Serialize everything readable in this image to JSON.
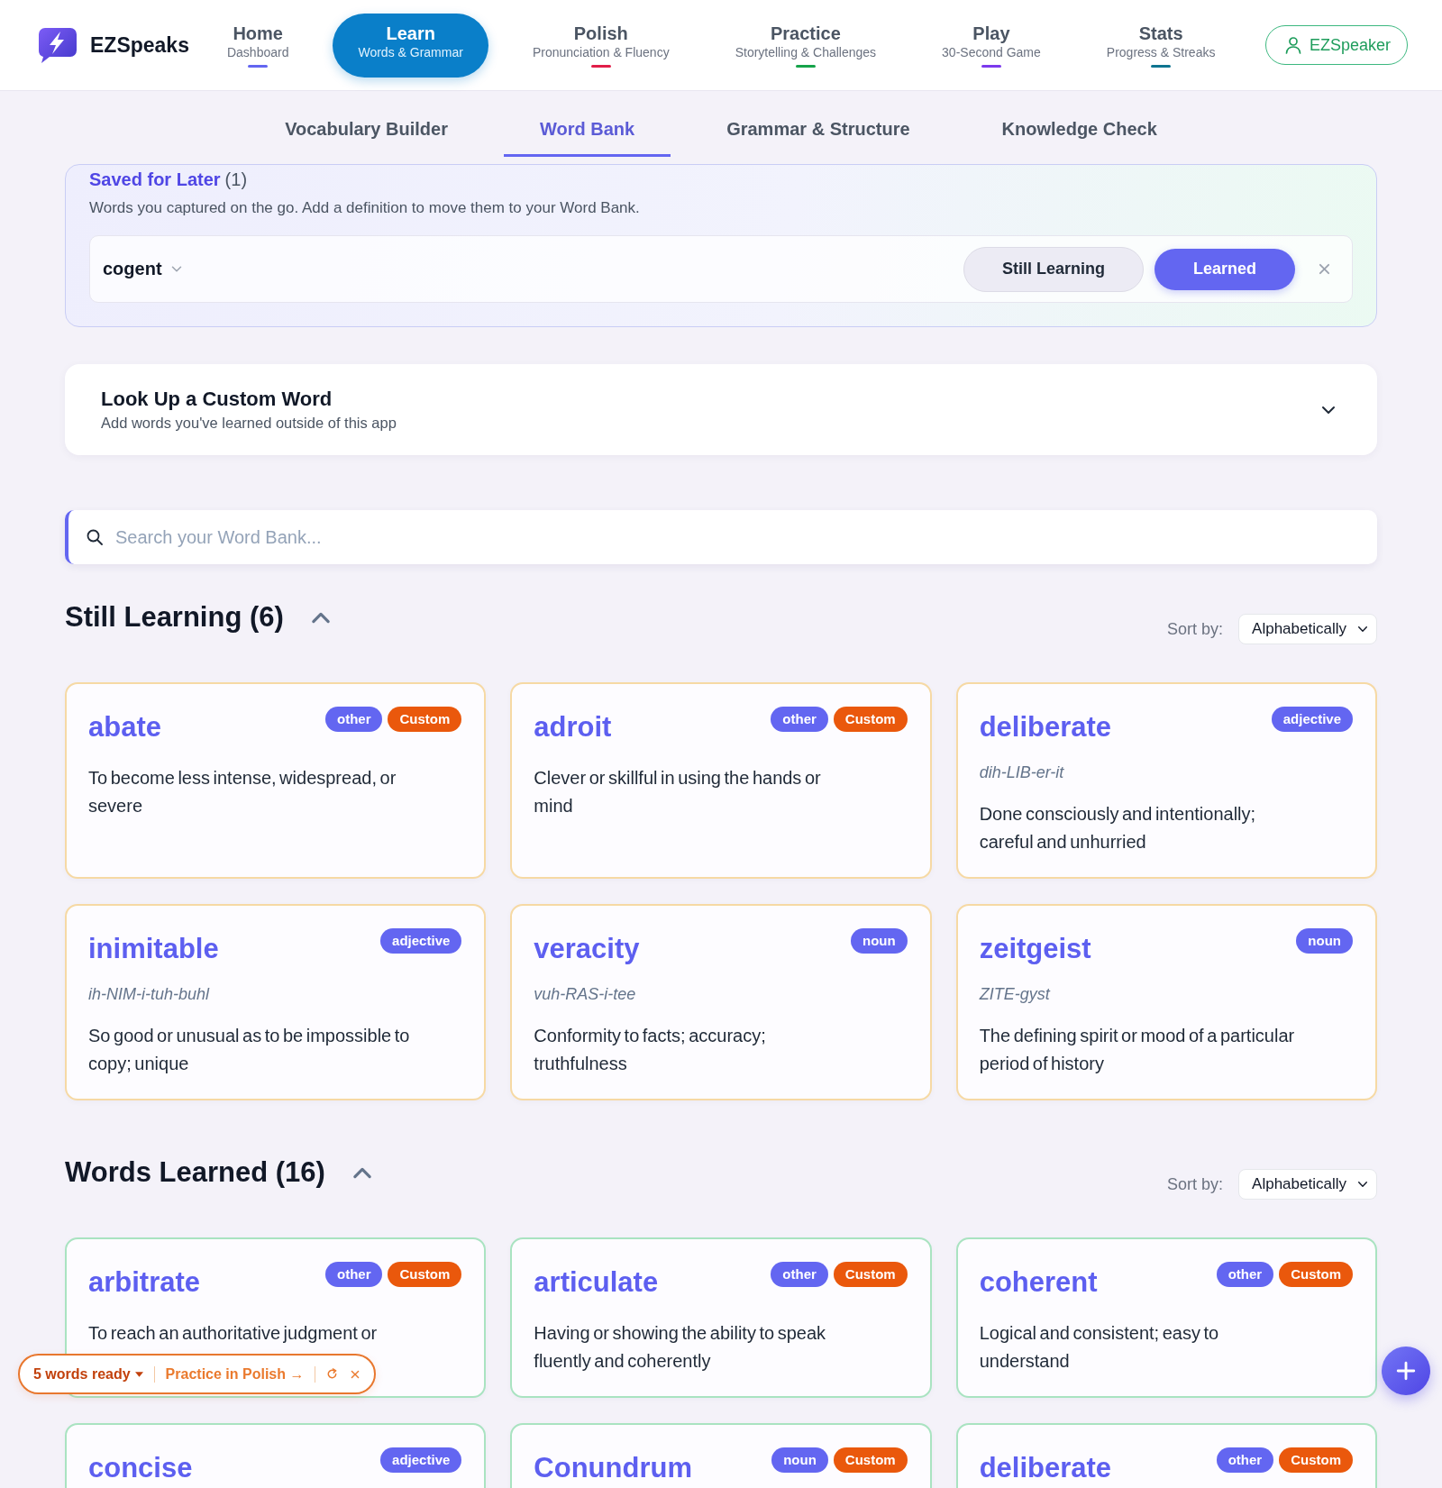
{
  "header": {
    "brand": "EZSpeaks",
    "nav": [
      {
        "label": "Home",
        "sublabel": "Dashboard",
        "selected": false,
        "color": "#6366f1"
      },
      {
        "label": "Learn",
        "sublabel": "Words & Grammar",
        "selected": true
      },
      {
        "label": "Polish",
        "sublabel": "Pronunciation & Fluency",
        "selected": false,
        "color": "#e11d48"
      },
      {
        "label": "Practice",
        "sublabel": "Storytelling & Challenges",
        "selected": false,
        "color": "#16a34a"
      },
      {
        "label": "Play",
        "sublabel": "30-Second Game",
        "selected": false,
        "color": "#7c3aed"
      },
      {
        "label": "Stats",
        "sublabel": "Progress & Streaks",
        "selected": false,
        "color": "#0e7490"
      }
    ],
    "account": "EZSpeaker"
  },
  "subtabs": [
    {
      "label": "Vocabulary Builder",
      "selected": false
    },
    {
      "label": "Word Bank",
      "selected": true
    },
    {
      "label": "Grammar & Structure",
      "selected": false
    },
    {
      "label": "Knowledge Check",
      "selected": false
    }
  ],
  "saved_for_later": {
    "title": "Saved for Later",
    "count": "(1)",
    "description": "Words you captured on the go. Add a definition to move them to your Word Bank.",
    "items": [
      {
        "word": "cogent",
        "actions": [
          {
            "label": "Still Learning",
            "kind": "secondary"
          },
          {
            "label": "Learned",
            "kind": "primary"
          }
        ]
      }
    ]
  },
  "custom_word": {
    "title": "Look Up a Custom Word",
    "subtitle": "Add words you've learned outside of this app",
    "expanded": false
  },
  "search": {
    "placeholder": "Search your Word Bank..."
  },
  "sections": [
    {
      "title": "Still Learning (6)",
      "kind": "learning",
      "expanded": true,
      "sort_label": "Sort by:",
      "sort_value": "Alphabetically",
      "cards": [
        {
          "word": "abate",
          "tags": [
            {
              "label": "other",
              "kind": "pos"
            },
            {
              "label": "Custom",
              "kind": "custom"
            }
          ],
          "definition": "To become less intense, widespread, or severe"
        },
        {
          "word": "adroit",
          "tags": [
            {
              "label": "other",
              "kind": "pos"
            },
            {
              "label": "Custom",
              "kind": "custom"
            }
          ],
          "definition": "Clever or skillful in using the hands or mind"
        },
        {
          "word": "deliberate",
          "tags": [
            {
              "label": "adjective",
              "kind": "pos"
            }
          ],
          "pronunciation": "dih-LIB-er-it",
          "definition": "Done consciously and intentionally; careful and unhurried"
        },
        {
          "word": "inimitable",
          "tags": [
            {
              "label": "adjective",
              "kind": "pos"
            }
          ],
          "pronunciation": "ih-NIM-i-tuh-buhl",
          "definition": "So good or unusual as to be impossible to copy; unique"
        },
        {
          "word": "veracity",
          "tags": [
            {
              "label": "noun",
              "kind": "pos"
            }
          ],
          "pronunciation": "vuh-RAS-i-tee",
          "definition": "Conformity to facts; accuracy; truthfulness"
        },
        {
          "word": "zeitgeist",
          "tags": [
            {
              "label": "noun",
              "kind": "pos"
            }
          ],
          "pronunciation": "ZITE-gyst",
          "definition": "The defining spirit or mood of a particular period of history"
        }
      ]
    },
    {
      "title": "Words Learned (16)",
      "kind": "learned",
      "expanded": true,
      "sort_label": "Sort by:",
      "sort_value": "Alphabetically",
      "cards": [
        {
          "word": "arbitrate",
          "tags": [
            {
              "label": "other",
              "kind": "pos"
            },
            {
              "label": "Custom",
              "kind": "custom"
            }
          ],
          "definition": "To reach an authoritative judgment or"
        },
        {
          "word": "articulate",
          "tags": [
            {
              "label": "other",
              "kind": "pos"
            },
            {
              "label": "Custom",
              "kind": "custom"
            }
          ],
          "definition": "Having or showing the ability to speak fluently and coherently"
        },
        {
          "word": "coherent",
          "tags": [
            {
              "label": "other",
              "kind": "pos"
            },
            {
              "label": "Custom",
              "kind": "custom"
            }
          ],
          "definition": "Logical and consistent; easy to understand"
        },
        {
          "word": "concise",
          "tags": [
            {
              "label": "adjective",
              "kind": "pos"
            }
          ]
        },
        {
          "word": "Conundrum",
          "tags": [
            {
              "label": "noun",
              "kind": "pos"
            },
            {
              "label": "Custom",
              "kind": "custom"
            }
          ]
        },
        {
          "word": "deliberate",
          "tags": [
            {
              "label": "other",
              "kind": "pos"
            },
            {
              "label": "Custom",
              "kind": "custom"
            }
          ]
        }
      ]
    }
  ],
  "practice_bar": {
    "count": "5 words ready",
    "link": "Practice in Polish →"
  }
}
